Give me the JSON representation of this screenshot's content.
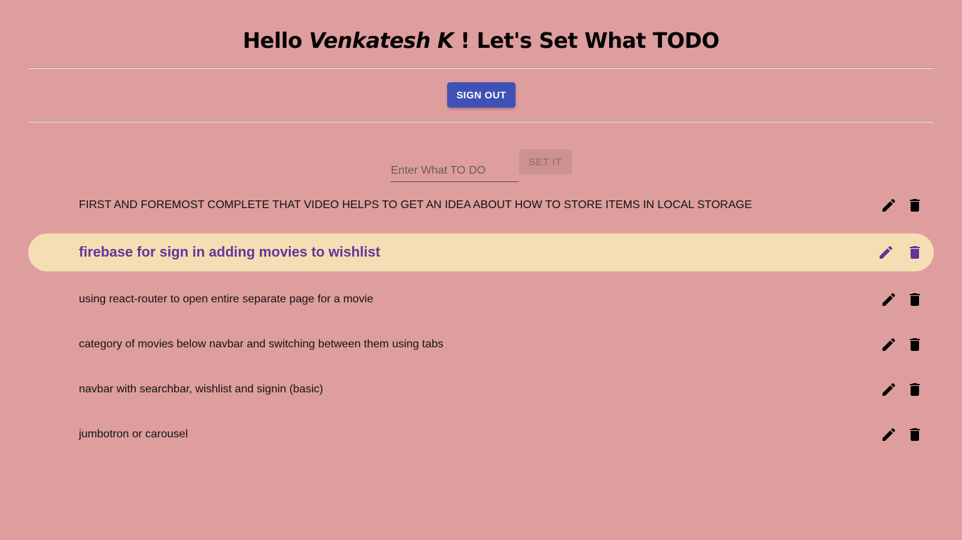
{
  "header": {
    "greeting": "Hello",
    "username": "Venkatesh K",
    "tagline": "! Let's Set What TODO"
  },
  "auth": {
    "signout_label": "SIGN OUT"
  },
  "form": {
    "placeholder": "Enter What TO DO",
    "value": "",
    "submit_label": "SET IT"
  },
  "todos": [
    {
      "text": "FIRST AND FOREMOST COMPLETE THAT VIDEO HELPS TO GET AN IDEA ABOUT HOW TO STORE ITEMS IN LOCAL STORAGE",
      "edit_icon": "pencil-icon",
      "delete_icon": "trash-icon"
    },
    {
      "text": "firebase for sign in adding movies to wishlist",
      "edit_icon": "pencil-icon",
      "delete_icon": "trash-icon"
    },
    {
      "text": "using react-router to open entire separate page for a movie",
      "edit_icon": "pencil-icon",
      "delete_icon": "trash-icon"
    },
    {
      "text": "category of movies below navbar and switching between them using tabs",
      "edit_icon": "pencil-icon",
      "delete_icon": "trash-icon"
    },
    {
      "text": "navbar with searchbar, wishlist and signin (basic)",
      "edit_icon": "pencil-icon",
      "delete_icon": "trash-icon"
    },
    {
      "text": "jumbotron or carousel",
      "edit_icon": "pencil-icon",
      "delete_icon": "trash-icon"
    }
  ],
  "colors": {
    "background": "#de9e9e",
    "signout_button": "#3f51b5",
    "highlight_background": "#f5deb3",
    "highlight_text": "#663399"
  }
}
